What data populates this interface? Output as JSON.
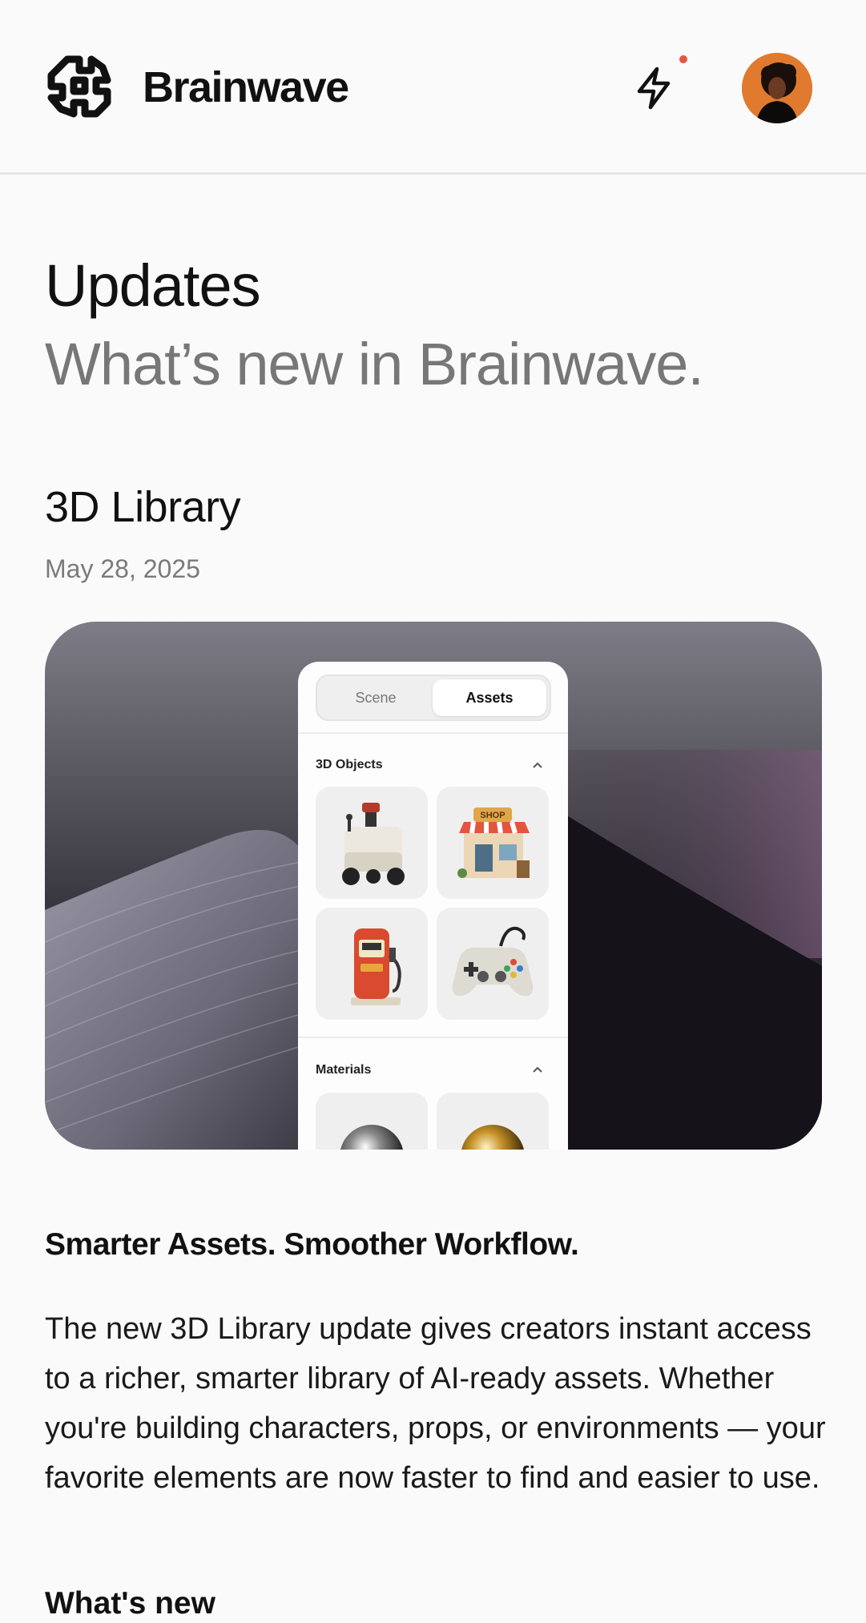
{
  "header": {
    "brand": "Brainwave",
    "logo_icon": "brainwave-logo-icon",
    "activity_icon": "lightning-bolt-icon",
    "notification_color": "#e8553f",
    "avatar_color": "#e07a2e"
  },
  "page": {
    "title": "Updates",
    "subtitle": "What’s new in Brainwave."
  },
  "entry": {
    "title": "3D Library",
    "date": "May 28, 2025",
    "hero": {
      "tabs": [
        {
          "label": "Scene",
          "selected": false
        },
        {
          "label": "Assets",
          "selected": true
        }
      ],
      "sections": [
        {
          "label": "3D Objects",
          "expanded": true,
          "items": [
            "delivery-robot-icon",
            "shop-icon",
            "gas-pump-icon",
            "gamepad-icon"
          ],
          "shop_sign": "SHOP"
        },
        {
          "label": "Materials",
          "expanded": true,
          "items": [
            "chrome-sphere-icon",
            "gold-sphere-icon"
          ]
        }
      ]
    },
    "tagline": "Smarter Assets. Smoother Workflow.",
    "body": "The new 3D Library update gives creators instant access to a richer, smarter library of AI-ready assets. Whether you're building characters, props, or environments — your favorite elements are now faster to find and easier to use.",
    "next_heading": "What's new"
  }
}
